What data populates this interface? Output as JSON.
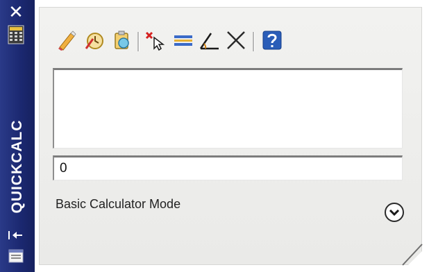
{
  "window": {
    "title": "QUICKCALC",
    "close_glyph": "✕"
  },
  "titlebar_icons": [
    "calculator-grid-icon",
    "auto-hide-icon",
    "properties-icon"
  ],
  "toolbar": {
    "buttons": [
      {
        "name": "clear",
        "icon": "eraser-icon"
      },
      {
        "name": "clear-history",
        "icon": "clear-history-icon"
      },
      {
        "name": "paste-value",
        "icon": "paste-to-command-line-icon"
      },
      {
        "name": "get-coordinates",
        "icon": "pick-point-icon"
      },
      {
        "name": "distance-between-two-points",
        "icon": "distance-icon"
      },
      {
        "name": "angle-of-line",
        "icon": "angle-icon"
      },
      {
        "name": "intersection-of-two-lines",
        "icon": "intersection-icon"
      },
      {
        "name": "help",
        "icon": "help-icon"
      }
    ]
  },
  "history": {
    "entries": []
  },
  "input": {
    "value": "0"
  },
  "mode": {
    "label": "Basic Calculator Mode",
    "toggle_icon": "chevron-down-circle-icon"
  },
  "colors": {
    "titlebar": "#1b2870",
    "panel": "#eeeeec",
    "field_border": "#7c7c7c"
  }
}
